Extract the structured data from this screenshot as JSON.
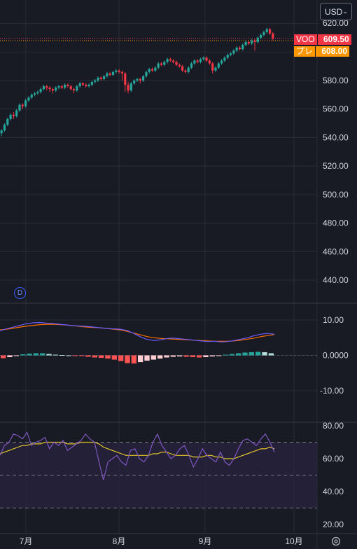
{
  "currency": {
    "label": "USD",
    "icon": "chevron-down-icon"
  },
  "price_tags": {
    "last": {
      "name": "VOO",
      "value": "609.50",
      "color": "#f23645"
    },
    "prev": {
      "name": "プレ",
      "value": "608.00",
      "color": "#ff9800"
    }
  },
  "event_marker": {
    "label": "D"
  },
  "main_axis": {
    "labels": [
      "620.00",
      "580.00",
      "560.00",
      "540.00",
      "520.00",
      "500.00",
      "480.00",
      "460.00",
      "440.00"
    ]
  },
  "macd_axis": {
    "labels": [
      "10.00",
      "0.0000",
      "-10.00"
    ]
  },
  "rsi_axis": {
    "labels": [
      "80.00",
      "60.00",
      "40.00",
      "20.00"
    ]
  },
  "time_axis": {
    "labels": [
      "7月",
      "8月",
      "9月",
      "10月"
    ]
  },
  "settings_icon": "gear-icon",
  "chart_data": {
    "type": "candlestick",
    "symbol": "VOO",
    "x_labels": [
      "7月",
      "8月",
      "9月",
      "10月"
    ],
    "price_ylim": [
      430,
      625
    ],
    "candles": [
      [
        543,
        545,
        541,
        546
      ],
      [
        545,
        549,
        544,
        550
      ],
      [
        549,
        553,
        548,
        554
      ],
      [
        553,
        556,
        552,
        557
      ],
      [
        556,
        555,
        553,
        558
      ],
      [
        555,
        559,
        554,
        560
      ],
      [
        559,
        563,
        558,
        564
      ],
      [
        563,
        562,
        560,
        564
      ],
      [
        562,
        566,
        561,
        567
      ],
      [
        566,
        568,
        565,
        569
      ],
      [
        568,
        570,
        567,
        571
      ],
      [
        570,
        571,
        569,
        572
      ],
      [
        571,
        572,
        570,
        573
      ],
      [
        572,
        574,
        571,
        575
      ],
      [
        574,
        576,
        573,
        577
      ],
      [
        576,
        575,
        573,
        577
      ],
      [
        575,
        574,
        572,
        576
      ],
      [
        574,
        573,
        571,
        575
      ],
      [
        573,
        575,
        572,
        576
      ],
      [
        575,
        576,
        574,
        577
      ],
      [
        576,
        575,
        574,
        577
      ],
      [
        575,
        577,
        574,
        578
      ],
      [
        577,
        576,
        575,
        578
      ],
      [
        576,
        574,
        573,
        577
      ],
      [
        574,
        573,
        571,
        575
      ],
      [
        573,
        576,
        572,
        577
      ],
      [
        576,
        578,
        575,
        579
      ],
      [
        578,
        577,
        576,
        579
      ],
      [
        577,
        576,
        575,
        578
      ],
      [
        576,
        577,
        575,
        578
      ],
      [
        577,
        579,
        576,
        580
      ],
      [
        579,
        580,
        578,
        581
      ],
      [
        580,
        582,
        579,
        583
      ],
      [
        582,
        581,
        580,
        583
      ],
      [
        581,
        583,
        580,
        584
      ],
      [
        583,
        585,
        582,
        586
      ],
      [
        585,
        584,
        583,
        586
      ],
      [
        584,
        586,
        583,
        587
      ],
      [
        586,
        587,
        585,
        588
      ],
      [
        587,
        586,
        585,
        588
      ],
      [
        586,
        585,
        580,
        587
      ],
      [
        585,
        577,
        572,
        586
      ],
      [
        577,
        573,
        571,
        579
      ],
      [
        573,
        578,
        572,
        579
      ],
      [
        578,
        580,
        577,
        581
      ],
      [
        580,
        581,
        579,
        582
      ],
      [
        581,
        580,
        578,
        582
      ],
      [
        580,
        583,
        579,
        584
      ],
      [
        583,
        586,
        582,
        587
      ],
      [
        586,
        588,
        585,
        589
      ],
      [
        588,
        587,
        586,
        589
      ],
      [
        587,
        589,
        586,
        590
      ],
      [
        589,
        592,
        588,
        593
      ],
      [
        592,
        591,
        590,
        593
      ],
      [
        591,
        593,
        590,
        594
      ],
      [
        593,
        595,
        592,
        596
      ],
      [
        595,
        594,
        593,
        596
      ],
      [
        594,
        593,
        592,
        595
      ],
      [
        593,
        591,
        590,
        594
      ],
      [
        591,
        590,
        589,
        592
      ],
      [
        590,
        587,
        586,
        591
      ],
      [
        587,
        586,
        585,
        588
      ],
      [
        586,
        589,
        585,
        590
      ],
      [
        589,
        592,
        588,
        593
      ],
      [
        592,
        594,
        591,
        595
      ],
      [
        594,
        593,
        592,
        595
      ],
      [
        593,
        595,
        592,
        596
      ],
      [
        595,
        596,
        594,
        597
      ],
      [
        596,
        594,
        593,
        597
      ],
      [
        594,
        592,
        591,
        595
      ],
      [
        592,
        587,
        585,
        593
      ],
      [
        587,
        589,
        586,
        590
      ],
      [
        589,
        592,
        588,
        593
      ],
      [
        592,
        594,
        591,
        595
      ],
      [
        594,
        596,
        593,
        597
      ],
      [
        596,
        598,
        595,
        599
      ],
      [
        598,
        599,
        597,
        600
      ],
      [
        599,
        601,
        598,
        602
      ],
      [
        601,
        603,
        600,
        604
      ],
      [
        603,
        602,
        601,
        604
      ],
      [
        602,
        605,
        601,
        606
      ],
      [
        605,
        607,
        604,
        608
      ],
      [
        607,
        606,
        605,
        608
      ],
      [
        606,
        608,
        605,
        609
      ],
      [
        608,
        607,
        601,
        609
      ],
      [
        607,
        610,
        606,
        611
      ],
      [
        610,
        612,
        609,
        613
      ],
      [
        612,
        614,
        611,
        615
      ],
      [
        614,
        616,
        613,
        617
      ],
      [
        616,
        613,
        612,
        617
      ],
      [
        613,
        609.5,
        608,
        614
      ]
    ],
    "macd": {
      "ylim": [
        -15,
        12
      ],
      "macd_line": [
        7,
        7.5,
        8,
        8.5,
        9,
        9.2,
        9.3,
        9.1,
        9,
        8.8,
        8.6,
        8.4,
        8.3,
        8.2,
        8.0,
        7.8,
        7.6,
        7.5,
        7.4,
        7.0,
        6.2,
        5.2,
        4.5,
        4.2,
        4.4,
        4.8,
        4.9,
        4.7,
        4.5,
        4.3,
        4.1,
        3.9,
        4.0,
        3.8,
        3.9,
        4.2,
        4.6,
        5.0,
        5.6,
        6.0,
        6.2,
        6.0
      ],
      "signal_line": [
        7.2,
        7.4,
        7.7,
        8.0,
        8.3,
        8.5,
        8.7,
        8.8,
        8.8,
        8.7,
        8.6,
        8.4,
        8.2,
        8.0,
        7.9,
        7.8,
        7.6,
        7.4,
        7.2,
        6.8,
        6.3,
        5.8,
        5.3,
        5.0,
        4.8,
        4.7,
        4.6,
        4.5,
        4.4,
        4.3,
        4.2,
        4.1,
        4.0,
        4.0,
        4.0,
        4.1,
        4.3,
        4.6,
        4.9,
        5.3,
        5.6,
        5.9
      ],
      "histogram": [
        -0.8,
        -0.5,
        -0.2,
        0.3,
        0.5,
        0.6,
        0.6,
        0.4,
        0.2,
        0.1,
        0,
        -0.1,
        -0.2,
        -0.4,
        -0.6,
        -0.7,
        -0.9,
        -1.2,
        -1.6,
        -2.2,
        -2.3,
        -1.9,
        -1.5,
        -1.2,
        -0.9,
        -0.6,
        -0.4,
        -0.3,
        -0.4,
        -0.5,
        -0.6,
        -0.5,
        -0.3,
        -0.1,
        0.2,
        0.4,
        0.6,
        0.8,
        0.9,
        1.0,
        0.9,
        0.6
      ]
    },
    "rsi": {
      "ylim": [
        17,
        82
      ],
      "levels": [
        70,
        50,
        30
      ],
      "rsi_line": [
        62,
        68,
        70,
        75,
        74,
        72,
        76,
        68,
        70,
        71,
        73,
        66,
        70,
        68,
        71,
        65,
        67,
        69,
        71,
        75,
        72,
        70,
        58,
        47,
        58,
        60,
        62,
        58,
        56,
        65,
        66,
        60,
        58,
        62,
        70,
        75,
        68,
        64,
        60,
        62,
        66,
        68,
        62,
        55,
        60,
        66,
        62,
        60,
        58,
        64,
        58,
        56,
        60,
        66,
        71,
        72,
        70,
        68,
        72,
        75,
        70,
        64
      ],
      "rsi_ma": [
        63,
        64,
        65,
        66,
        67,
        68,
        68,
        69,
        69,
        69,
        70,
        70,
        70,
        70,
        70,
        69,
        69,
        69,
        70,
        70,
        70,
        70,
        69,
        67,
        66,
        65,
        64,
        63,
        62,
        62,
        62,
        62,
        62,
        62,
        63,
        63,
        64,
        64,
        63,
        62,
        62,
        62,
        62,
        61,
        61,
        61,
        62,
        62,
        61,
        61,
        60,
        60,
        60,
        61,
        62,
        63,
        64,
        65,
        66,
        66,
        67,
        66
      ]
    }
  }
}
